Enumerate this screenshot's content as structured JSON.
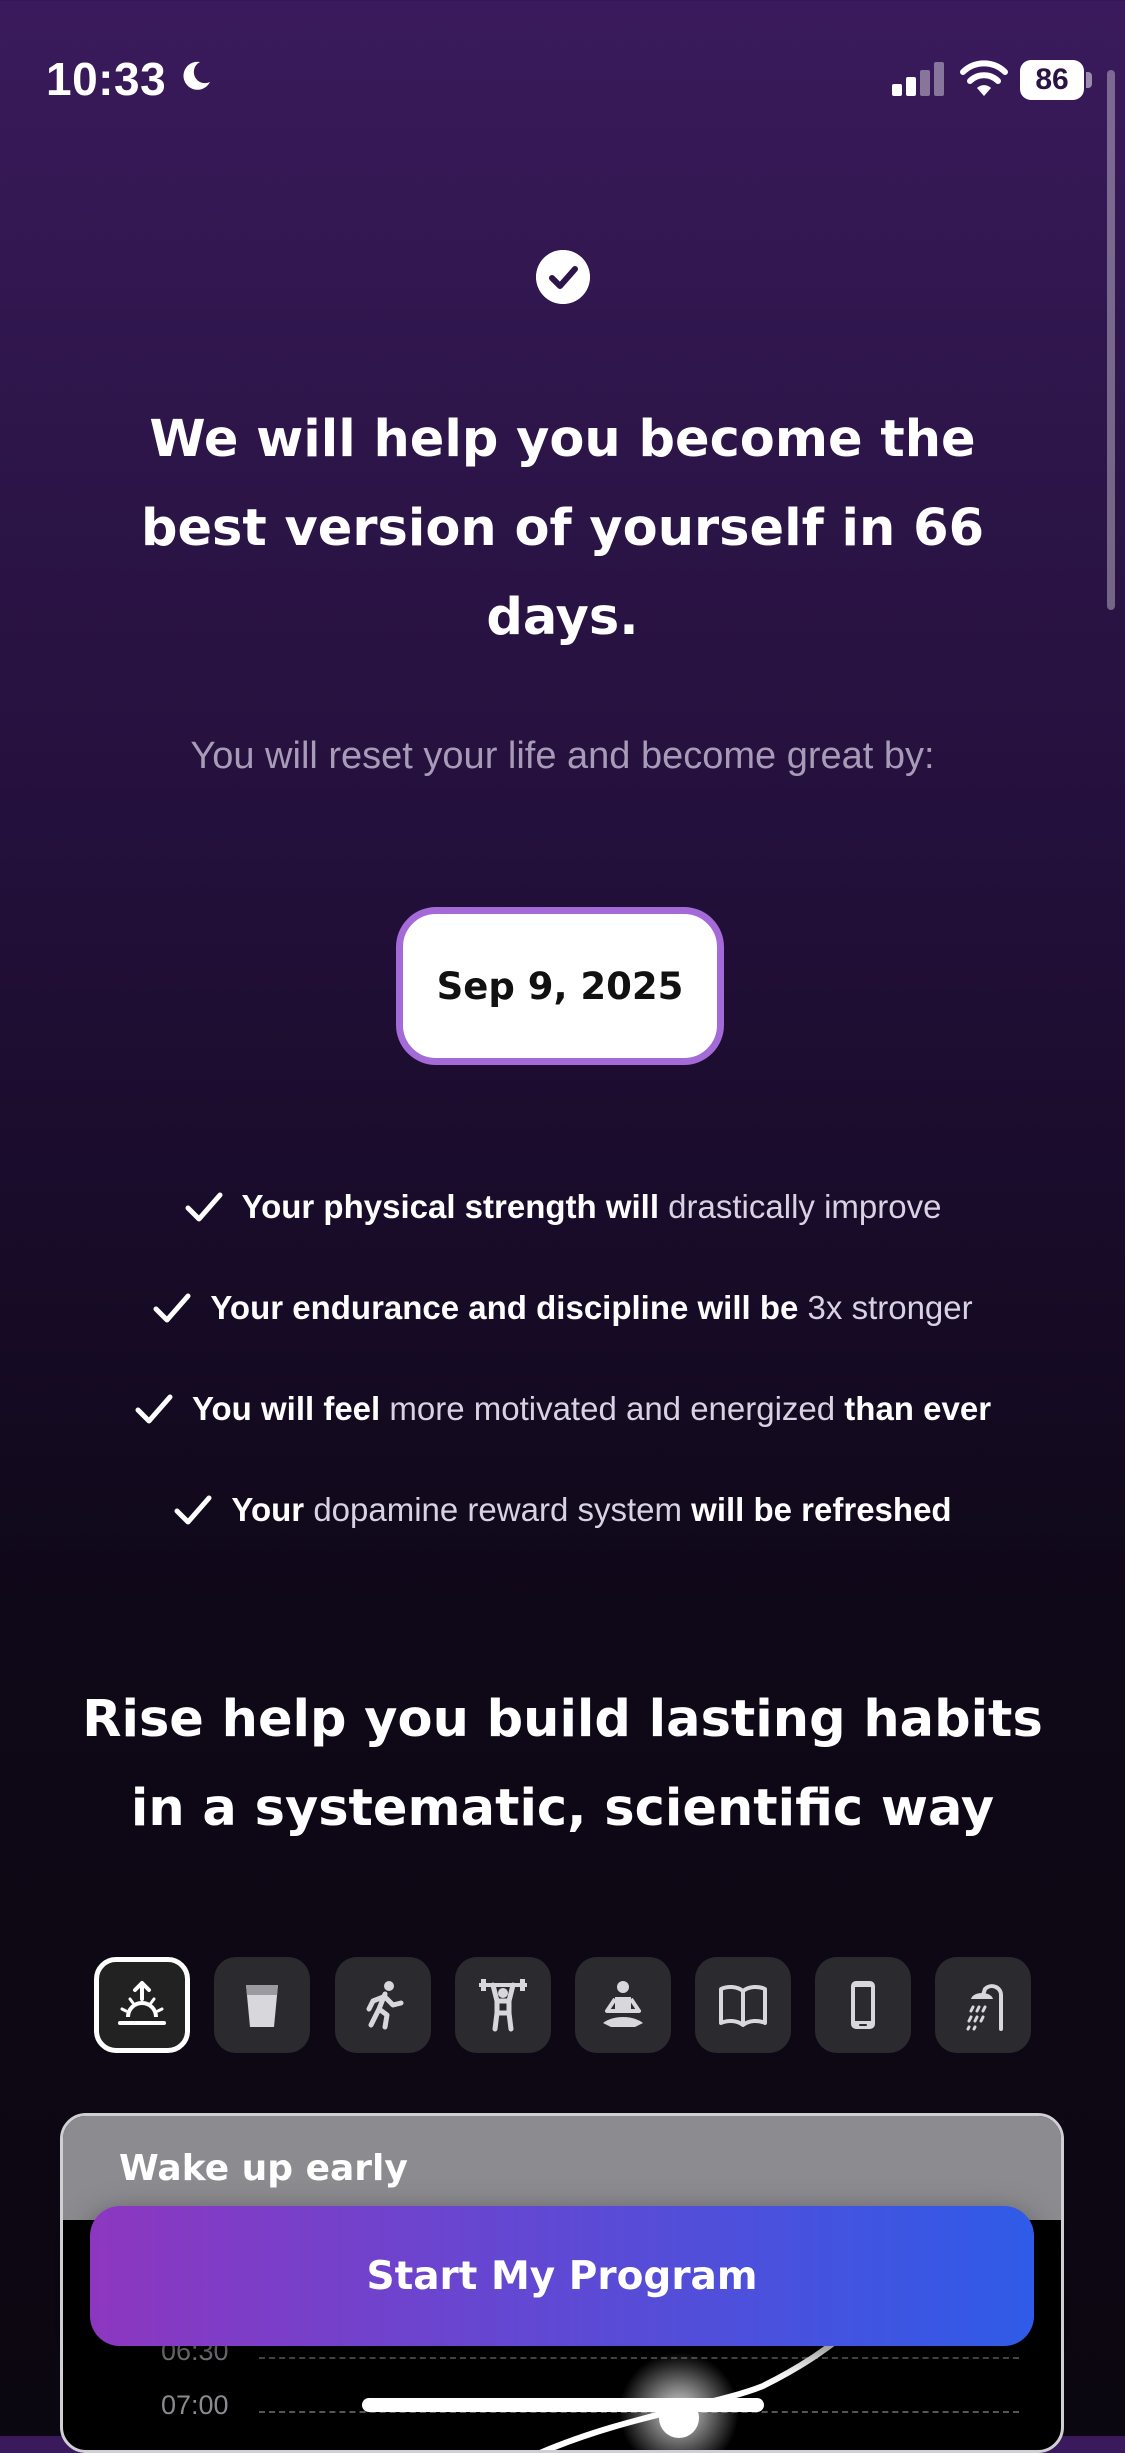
{
  "status_bar": {
    "time": "10:33",
    "battery": "86"
  },
  "header": {
    "headline_line1": "We will help you become the",
    "headline_line2": "best version of yourself in 66",
    "headline_line3": "days.",
    "subhead": "You will reset your life and become great by:"
  },
  "target_date": "Sep 9, 2025",
  "benefits": [
    {
      "a": "Your physical strength will",
      "b": " drastically improve",
      "c": ""
    },
    {
      "a": "Your endurance and discipline will be",
      "b": " 3x stronger",
      "c": ""
    },
    {
      "a": "You will feel",
      "b": " more motivated and energized",
      "c": " than ever"
    },
    {
      "a": "Your",
      "b": " dopamine reward system",
      "c": " will be refreshed"
    }
  ],
  "section": {
    "title_line1": "Rise help you build lasting habits",
    "title_line2": "in a systematic, scientific way"
  },
  "habit_icons": [
    "sunrise-icon",
    "water-glass-icon",
    "running-icon",
    "weightlifting-icon",
    "meditation-icon",
    "book-icon",
    "phone-icon",
    "shower-icon"
  ],
  "habit_card": {
    "title": "Wake up early",
    "ticks": [
      "06:30",
      "07:00"
    ]
  },
  "cta": {
    "label": "Start My Program"
  },
  "colors": {
    "accent_border": "#a46ad8",
    "cta_start": "#8d37c0",
    "cta_end": "#2f5be8"
  }
}
